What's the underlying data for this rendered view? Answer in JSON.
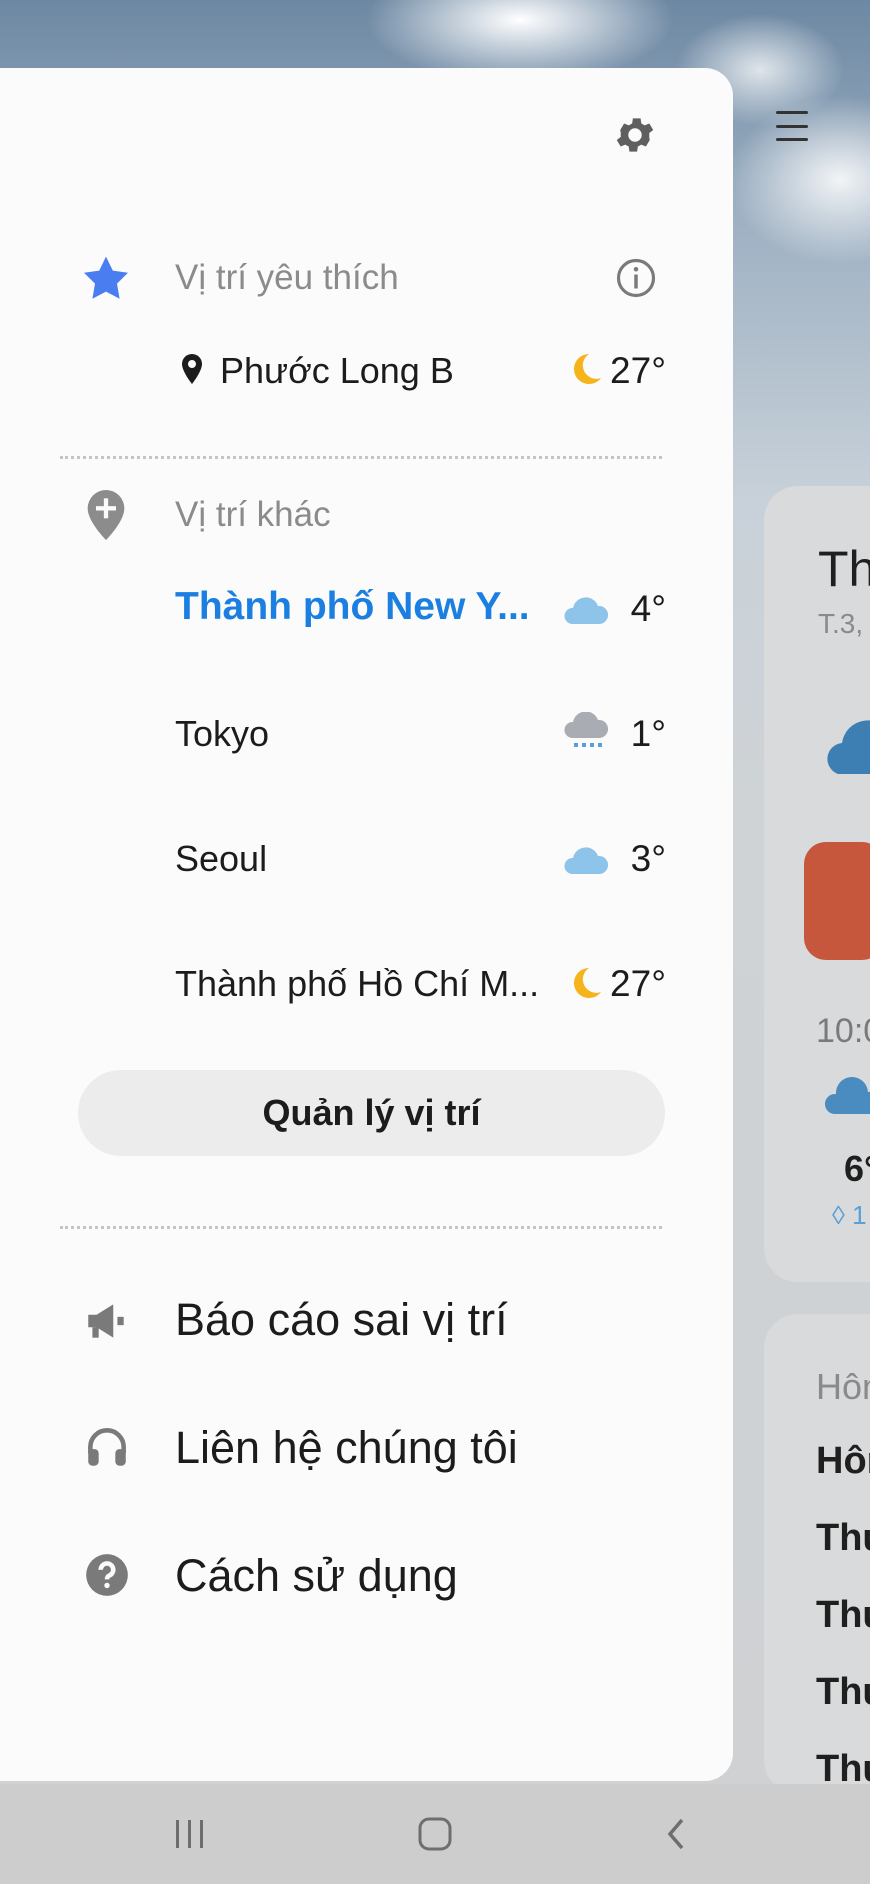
{
  "background": {
    "card_title_partial": "Th",
    "card_date_partial": "T.3,",
    "hourly_time_partial": "10:0",
    "hourly_temp_partial": "6°",
    "hourly_precip_partial": "1",
    "forecast_header_partial": "Hôm",
    "forecast_rows_partial": [
      "Hôm",
      "Thứ",
      "Thứ",
      "Thứ",
      "Thứ"
    ]
  },
  "drawer": {
    "favorites": {
      "label": "Vị trí yêu thích",
      "items": [
        {
          "name": "Phước Long B",
          "temp": "27°",
          "icon": "moon-icon"
        }
      ]
    },
    "other": {
      "label": "Vị trí khác",
      "items": [
        {
          "name": "Thành phố New Y...",
          "temp": "4°",
          "icon": "cloud-icon",
          "active": true
        },
        {
          "name": "Tokyo",
          "temp": "1°",
          "icon": "sleet-icon"
        },
        {
          "name": "Seoul",
          "temp": "3°",
          "icon": "cloud-icon"
        },
        {
          "name": "Thành phố Hồ Chí M...",
          "temp": "27°",
          "icon": "moon-icon"
        }
      ]
    },
    "manage_button": "Quản lý vị trí",
    "menu": [
      {
        "label": "Báo cáo sai vị trí",
        "icon": "megaphone-icon"
      },
      {
        "label": "Liên hệ chúng tôi",
        "icon": "headset-icon"
      },
      {
        "label": "Cách sử dụng",
        "icon": "help-icon"
      }
    ]
  },
  "colors": {
    "accent": "#1a7fe0",
    "star": "#4a7df0",
    "moon": "#f6b41c",
    "cloud": "#8ec3ea"
  }
}
